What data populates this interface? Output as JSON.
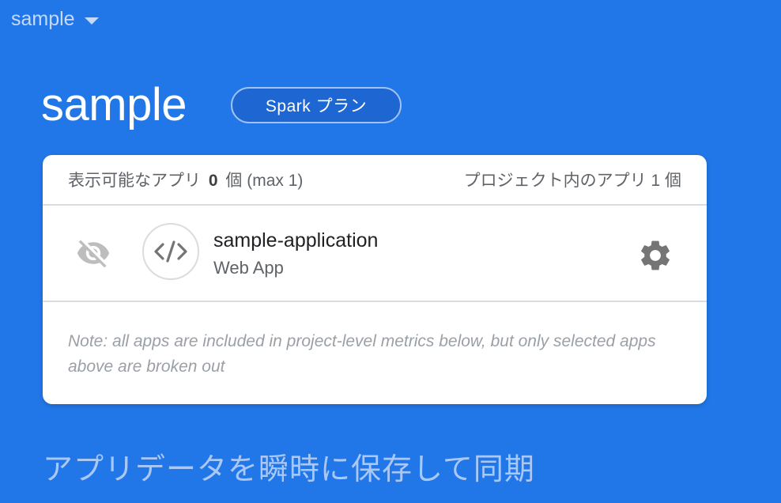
{
  "project_switcher": {
    "label": "sample"
  },
  "project": {
    "title": "sample",
    "plan_badge": "Spark プラン"
  },
  "apps_card": {
    "header": {
      "visible_prefix": "表示可能なアプリ",
      "visible_count": "0",
      "visible_suffix": "個 (max 1)",
      "total_label": "プロジェクト内のアプリ 1 個"
    },
    "apps": [
      {
        "name": "sample-application",
        "platform": "Web App",
        "icon": "code-icon"
      }
    ],
    "note": "Note: all apps are included in project-level metrics below, but only selected apps above are broken out"
  },
  "section": {
    "heading": "アプリデータを瞬時に保存して同期"
  },
  "colors": {
    "background": "#2277e8",
    "badge_bg": "#1e66d2",
    "card_bg": "#ffffff",
    "icon_gray": "#757575"
  }
}
